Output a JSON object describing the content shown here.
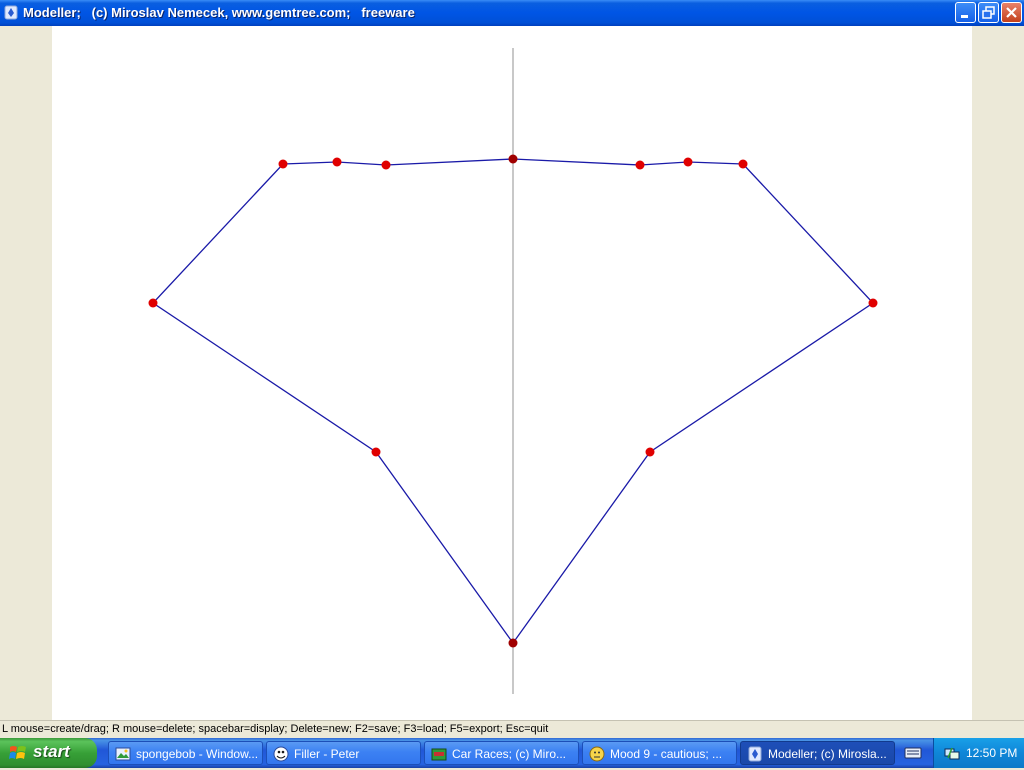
{
  "window": {
    "title": "Modeller;   (c) Miroslav Nemecek, www.gemtree.com;   freeware",
    "icon": "modeller-app-icon"
  },
  "title_buttons": {
    "minimize": "minimize-icon",
    "maximize": "maximize-icon",
    "close": "close-icon"
  },
  "status_bar": {
    "text": "L mouse=create/drag; R mouse=delete; spacebar=display; Delete=new; F2=save; F3=load; F5=export; Esc=quit"
  },
  "taskbar": {
    "start_label": "start",
    "tasks": [
      {
        "label": "spongebob - Window...",
        "icon": "image-viewer-icon",
        "active": false
      },
      {
        "label": "Filler - Peter",
        "icon": "filler-app-icon",
        "active": false
      },
      {
        "label": "Car Races;   (c) Miro...",
        "icon": "car-races-icon",
        "active": false
      },
      {
        "label": "Mood 9 - cautious;  ...",
        "icon": "smiley-icon",
        "active": false
      },
      {
        "label": "Modeller;   (c) Mirosla...",
        "icon": "modeller-app-icon",
        "active": true
      }
    ],
    "tray_icon": "network-icon",
    "keyboard_icon": "keyboard-icon",
    "clock": "12:50 PM"
  },
  "colors": {
    "outline": "#1a1aa8",
    "vertex": "#e00000",
    "axis_vertex": "#a00000",
    "axis": "#c0c0c0",
    "canvas": "#ffffff"
  }
}
